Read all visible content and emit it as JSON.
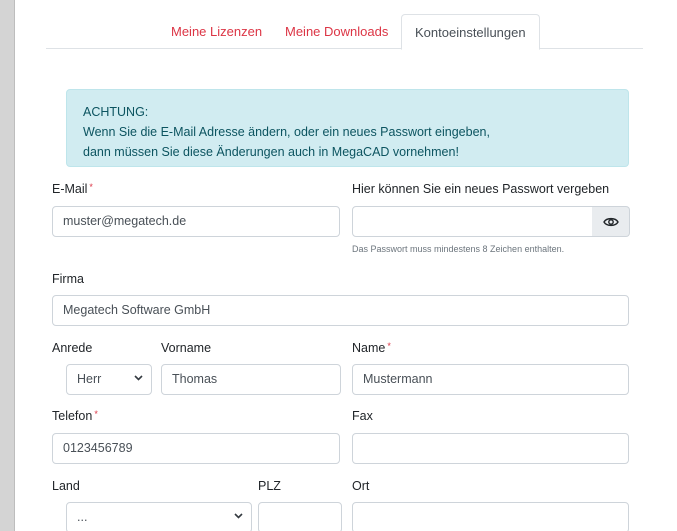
{
  "tabs": [
    {
      "label": "Meine Lizenzen"
    },
    {
      "label": "Meine Downloads"
    },
    {
      "label": "Kontoeinstellungen"
    }
  ],
  "alert": {
    "line1": "ACHTUNG:",
    "line2": "Wenn Sie die E-Mail Adresse ändern, oder ein neues Passwort eingeben,",
    "line3": "dann müssen Sie diese Änderungen auch in MegaCAD vornehmen!"
  },
  "form": {
    "email_label": "E-Mail",
    "email_value": "muster@megatech.de",
    "password_label": "Hier können Sie ein neues Passwort vergeben",
    "password_value": "",
    "password_help": "Das Passwort muss mindestens 8 Zeichen enthalten.",
    "firma_label": "Firma",
    "firma_value": "Megatech Software GmbH",
    "anrede_label": "Anrede",
    "anrede_value": "Herr",
    "vorname_label": "Vorname",
    "vorname_value": "Thomas",
    "name_label": "Name",
    "name_value": "Mustermann",
    "telefon_label": "Telefon",
    "telefon_value": "0123456789",
    "fax_label": "Fax",
    "fax_value": "",
    "land_label": "Land",
    "land_value": "...",
    "plz_label": "PLZ",
    "plz_value": "",
    "ort_label": "Ort",
    "ort_value": "",
    "required_mark": "*"
  },
  "icons": {
    "eye": "eye-icon",
    "chevron": "chevron-down-icon"
  },
  "colors": {
    "accent": "#dc3545",
    "alert_bg": "#d1ecf1",
    "alert_text": "#0c5460"
  }
}
